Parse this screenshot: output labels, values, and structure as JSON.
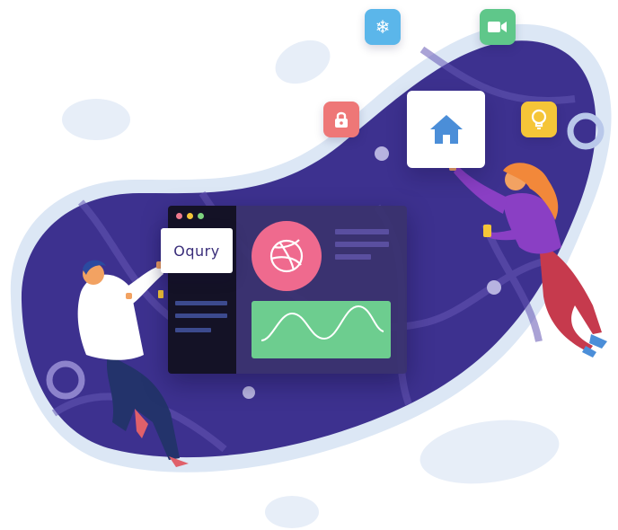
{
  "brand": {
    "name": "Oqury"
  },
  "colors": {
    "blob": "#3d318f",
    "blob_outline": "#dbe6f4",
    "accent_pink": "#ef6a8e",
    "accent_green": "#6dcd8f",
    "tile_blue": "#5bb6ea",
    "tile_green": "#5fc78a",
    "tile_red": "#ee7777",
    "tile_yellow": "#f5c538"
  },
  "icons": [
    {
      "name": "snowflake-icon"
    },
    {
      "name": "video-camera-icon"
    },
    {
      "name": "lock-icon"
    },
    {
      "name": "home-icon"
    },
    {
      "name": "lightbulb-icon"
    },
    {
      "name": "dribbble-icon"
    }
  ],
  "window": {
    "traffic_lights": [
      "#f07a8e",
      "#f5c538",
      "#7ed37e"
    ]
  }
}
